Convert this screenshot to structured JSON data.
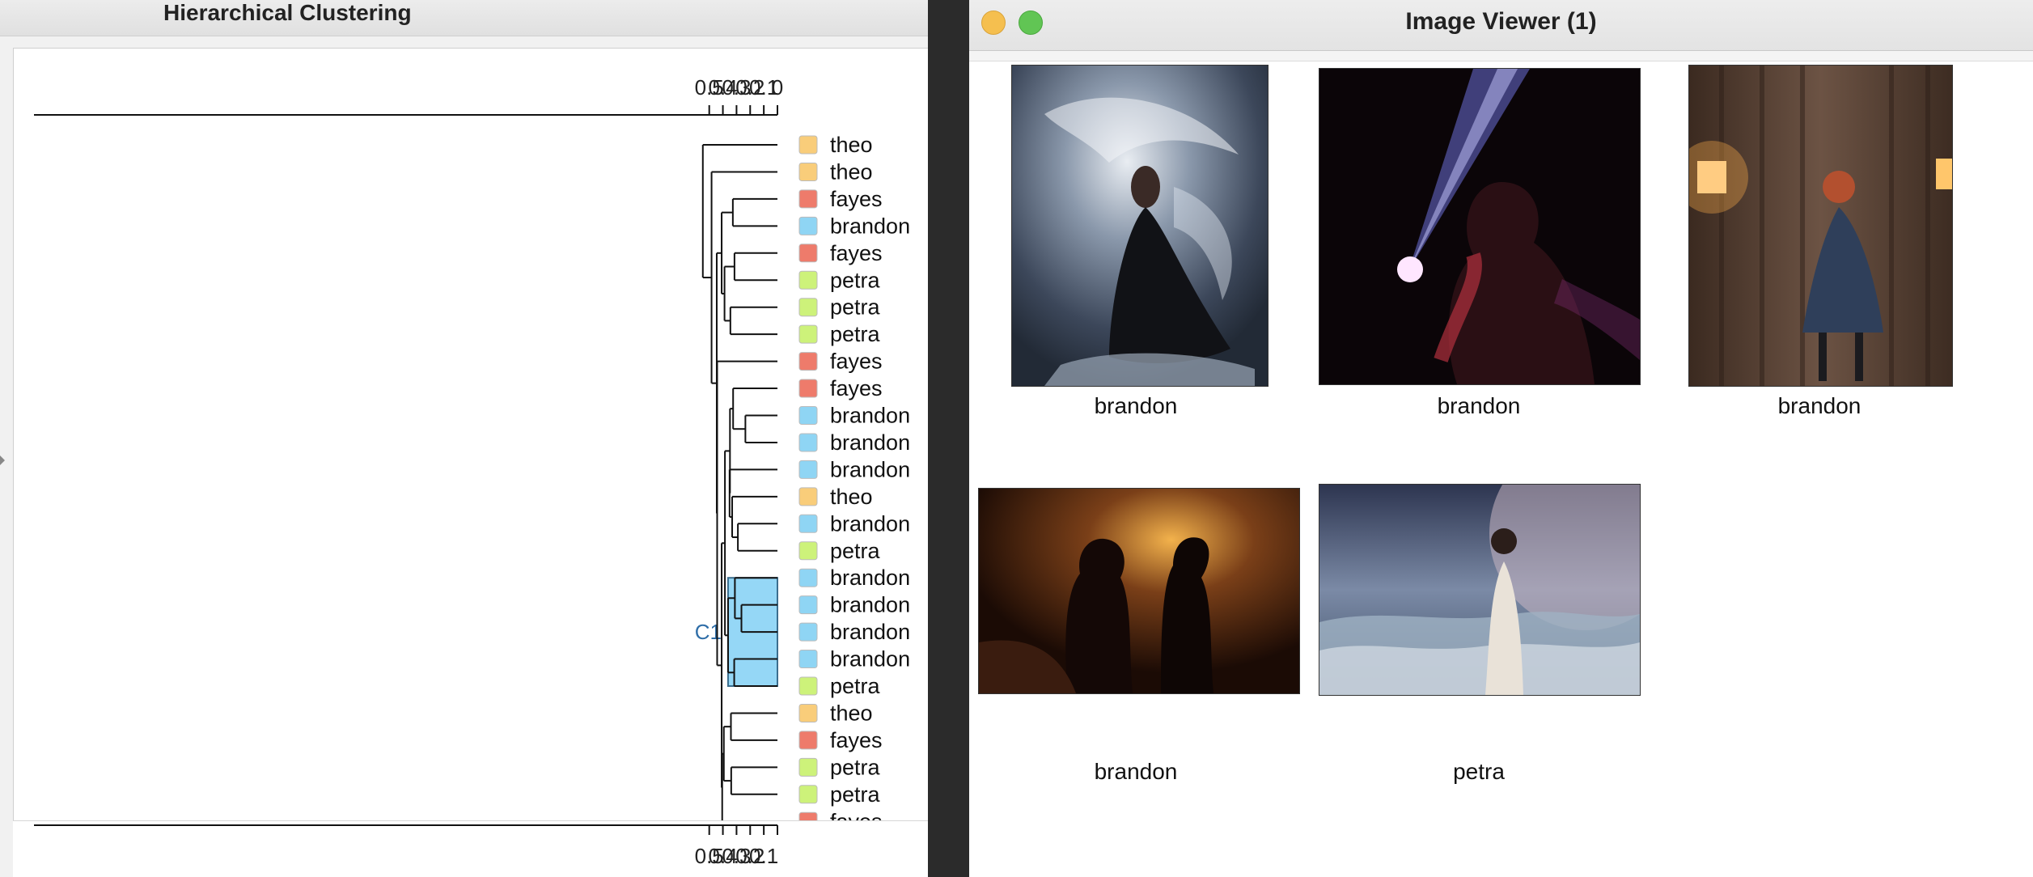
{
  "left_window": {
    "title": "Hierarchical Clustering",
    "axis_ticks": [
      "0.5",
      "0.4",
      "0.3",
      "0.2",
      "0.1",
      "0"
    ],
    "cluster_label": "C1",
    "group_colors": {
      "theo": "#f9cd7a",
      "fayes": "#ee7b6b",
      "brandon": "#8fd5f4",
      "petra": "#cdf27a"
    },
    "selection_color": "#95d7f6",
    "leaves": [
      {
        "label": "theo",
        "group": "theo"
      },
      {
        "label": "theo",
        "group": "theo"
      },
      {
        "label": "fayes",
        "group": "fayes"
      },
      {
        "label": "brandon",
        "group": "brandon"
      },
      {
        "label": "fayes",
        "group": "fayes"
      },
      {
        "label": "petra",
        "group": "petra"
      },
      {
        "label": "petra",
        "group": "petra"
      },
      {
        "label": "petra",
        "group": "petra"
      },
      {
        "label": "fayes",
        "group": "fayes"
      },
      {
        "label": "fayes",
        "group": "fayes"
      },
      {
        "label": "brandon",
        "group": "brandon"
      },
      {
        "label": "brandon",
        "group": "brandon"
      },
      {
        "label": "brandon",
        "group": "brandon"
      },
      {
        "label": "theo",
        "group": "theo"
      },
      {
        "label": "brandon",
        "group": "brandon"
      },
      {
        "label": "petra",
        "group": "petra"
      },
      {
        "label": "brandon",
        "group": "brandon"
      },
      {
        "label": "brandon",
        "group": "brandon"
      },
      {
        "label": "brandon",
        "group": "brandon"
      },
      {
        "label": "brandon",
        "group": "brandon"
      },
      {
        "label": "petra",
        "group": "petra"
      },
      {
        "label": "theo",
        "group": "theo"
      },
      {
        "label": "fayes",
        "group": "fayes"
      },
      {
        "label": "petra",
        "group": "petra"
      },
      {
        "label": "petra",
        "group": "petra"
      },
      {
        "label": "fayes",
        "group": "fayes"
      }
    ]
  },
  "right_window": {
    "title": "Image Viewer (1)",
    "traffic_lights": {
      "minimize": "#f5bf4f",
      "zoom": "#61c554"
    },
    "images": [
      {
        "caption": "brandon",
        "scene": "woman seated in dark dress, swirling light smoke"
      },
      {
        "caption": "brandon",
        "scene": "silhouette with beam of light against dark red background"
      },
      {
        "caption": "brandon",
        "scene": "woman in dress by curtain with warm lamps"
      },
      {
        "caption": "brandon",
        "scene": "two silhouettes facing each other in warm backlight"
      },
      {
        "caption": "petra",
        "scene": "woman in white gown by water under large moon"
      }
    ]
  }
}
